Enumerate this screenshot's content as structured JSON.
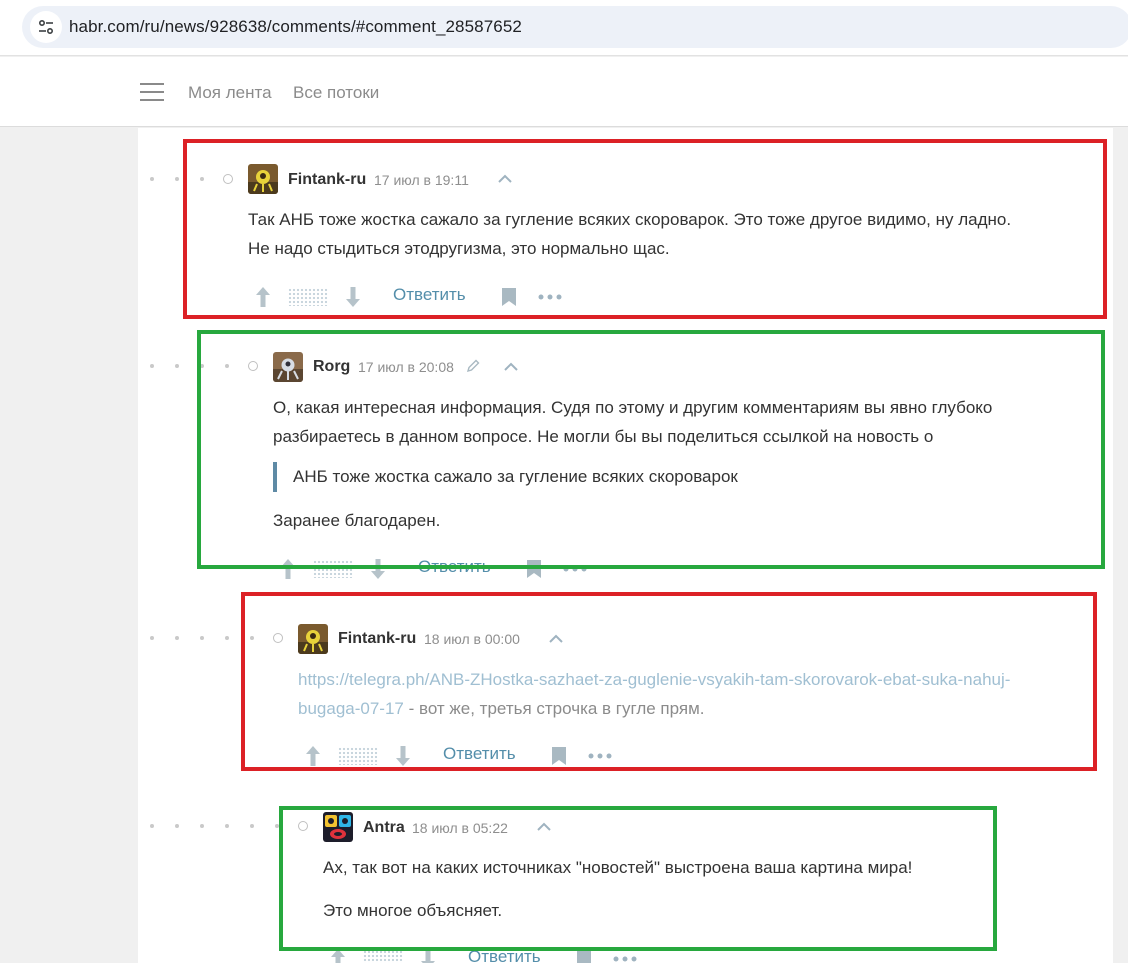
{
  "browser": {
    "url": "habr.com/ru/news/928638/comments/#comment_28587652"
  },
  "header": {
    "nav": [
      {
        "label": "Моя лента"
      },
      {
        "label": "Все потоки"
      }
    ]
  },
  "comments": [
    {
      "author": "Fintank-ru",
      "time": "17 июл в 19:11",
      "edited": false,
      "lines": [
        "Так АНБ тоже жостка сажало за гугление всяких скороварок. Это тоже другое видимо, ну ладно.",
        "Не надо стыдиться этодругизма, это нормально щас."
      ],
      "reply_label": "Ответить",
      "highlight": "#dc2126"
    },
    {
      "author": "Rorg",
      "time": "17 июл в 20:08",
      "edited": true,
      "lines": [
        "О, какая интересная информация. Судя по этому и другим комментариям вы явно глубоко",
        "разбираетесь в данном вопросе. Не могли бы вы поделиться ссылкой на новость о"
      ],
      "quote": "АНБ тоже жостка сажало за гугление всяких скороварок",
      "closing": "Заранее благодарен.",
      "reply_label": "Ответить",
      "highlight": "#27a83e"
    },
    {
      "author": "Fintank-ru",
      "time": "18 июл в 00:00",
      "edited": false,
      "link_line1": "https://telegra.ph/ANB-ZHostka-sazhaet-za-guglenie-vsyakih-tam-skorovarok-ebat-suka-nahuj-",
      "link_line2": "bugaga-07-17",
      "link_suffix": " - вот же, третья строчка в гугле прям.",
      "reply_label": "Ответить",
      "highlight": "#dc2126"
    },
    {
      "author": "Antra",
      "time": "18 июл в 05:22",
      "edited": false,
      "lines": [
        "Ах, так вот на каких источниках \"новостей\" выстроена ваша картина мира!"
      ],
      "closing": "Это многое объясняет.",
      "reply_label": "Ответить",
      "highlight": "#27a83e"
    }
  ]
}
